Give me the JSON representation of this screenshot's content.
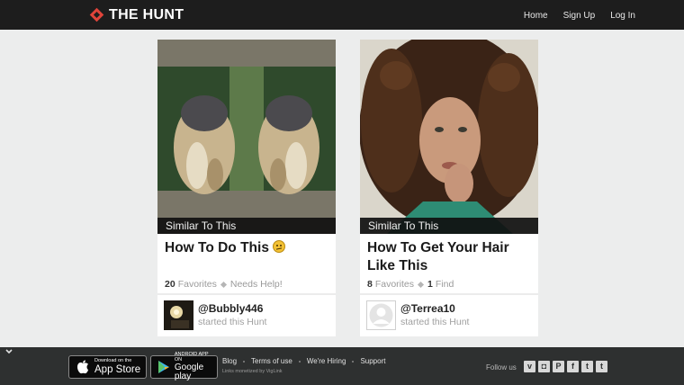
{
  "brand": {
    "name": "THE HUNT"
  },
  "nav": {
    "home": "Home",
    "signup": "Sign Up",
    "login": "Log In"
  },
  "cards": [
    {
      "banner": "Similar To This",
      "title": "How To Do This",
      "stats": {
        "favorites_count": "20",
        "favorites_label": "Favorites",
        "status": "Needs Help!"
      },
      "user": {
        "handle": "@Bubbly446",
        "action": "started this Hunt"
      }
    },
    {
      "banner": "Similar To This",
      "title_line1": "How To Get Your Hair",
      "title_line2": "Like This",
      "stats": {
        "favorites_count": "8",
        "favorites_label": "Favorites",
        "find_count": "1",
        "find_label": "Find"
      },
      "user": {
        "handle": "@Terrea10",
        "action": "started this Hunt"
      }
    }
  ],
  "footer": {
    "appstore": {
      "small": "Download on the",
      "big": "App Store"
    },
    "googleplay": {
      "small": "ANDROID APP ON",
      "big": "Google play"
    },
    "links": [
      "Blog",
      "Terms of use",
      "We're Hiring",
      "Support"
    ],
    "monetized": "Links monetized by VigLink",
    "follow_label": "Follow us",
    "socials": [
      "v",
      "◘",
      "P",
      "f",
      "t",
      "t"
    ]
  },
  "colors": {
    "topbar": "#1d1d1d",
    "brand_red": "#e0443a",
    "footer": "#2e3030",
    "page_bg": "#eceded"
  }
}
